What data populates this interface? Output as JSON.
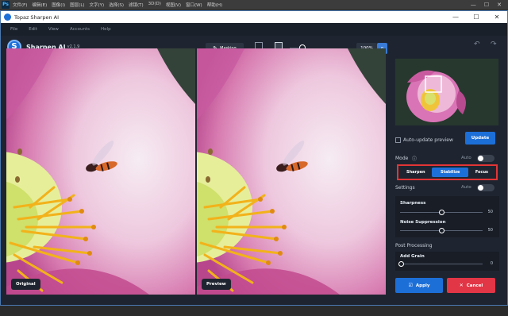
{
  "ps": {
    "logo": "Ps",
    "menu": [
      "文件(F)",
      "编辑(E)",
      "图像(I)",
      "图层(L)",
      "文字(Y)",
      "选择(S)",
      "滤镜(T)",
      "3D(D)",
      "视图(V)",
      "窗口(W)",
      "帮助(H)"
    ],
    "win_controls": [
      "—",
      "☐",
      "✕"
    ]
  },
  "window": {
    "title": "Topaz Sharpen AI",
    "controls": [
      "—",
      "☐",
      "✕"
    ]
  },
  "menubar": [
    "File",
    "Edit",
    "View",
    "Accounts",
    "Help"
  ],
  "brand": {
    "name": "Sharpen AI",
    "version": "v2.1.9"
  },
  "toolbar": {
    "masking_label": "Masking",
    "split_label": "Split",
    "sidebyside_label": "Side",
    "zoom": "100%",
    "undo_label": "Undo",
    "redo_label": "Redo"
  },
  "panes": {
    "left_tag": "Original",
    "right_tag": "Preview"
  },
  "panel": {
    "auto_update_label": "Auto-update preview",
    "update_label": "Update",
    "mode_label": "Mode",
    "mode_info_icon": "ⓘ",
    "auto_label": "Auto",
    "modes": [
      "Sharpen",
      "Stabilize",
      "Focus"
    ],
    "active_mode": "Stabilize",
    "settings_label": "Settings",
    "sharpness_label": "Sharpness",
    "sharpness_value": "50",
    "noise_label": "Noise Suppression",
    "noise_value": "50",
    "post_label": "Post Processing",
    "grain_label": "Add Grain",
    "grain_value": "0",
    "apply_label": "Apply",
    "cancel_label": "Cancel"
  },
  "colors": {
    "accent": "#1d6fd8",
    "cancel": "#e23545",
    "highlight": "#e23535"
  }
}
